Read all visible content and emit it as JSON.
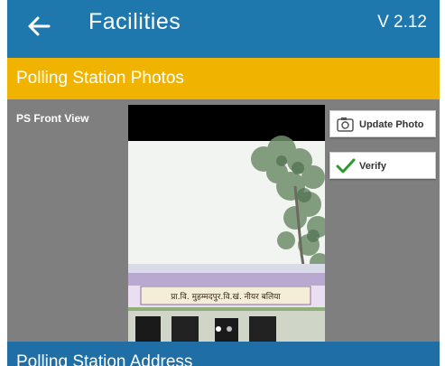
{
  "header": {
    "title": "Facilities",
    "version": "V 2.12",
    "back_icon": "arrow-left-icon"
  },
  "section": {
    "title": "Polling Station Photos"
  },
  "photo_card": {
    "label": "PS Front View",
    "update_button": "Update Photo",
    "verify_button": "Verify",
    "update_icon": "camera-icon",
    "verify_icon": "checkmark-icon",
    "sign_text": "प्रा.वि. मुहम्मदपुर.वि.खं. नीयर बलिया"
  },
  "next_section": {
    "title": "Polling Station Address"
  },
  "colors": {
    "appbar": "#1f78ad",
    "section": "#f0b400",
    "content": "#7f7f7f",
    "check": "#2e9a2e"
  }
}
